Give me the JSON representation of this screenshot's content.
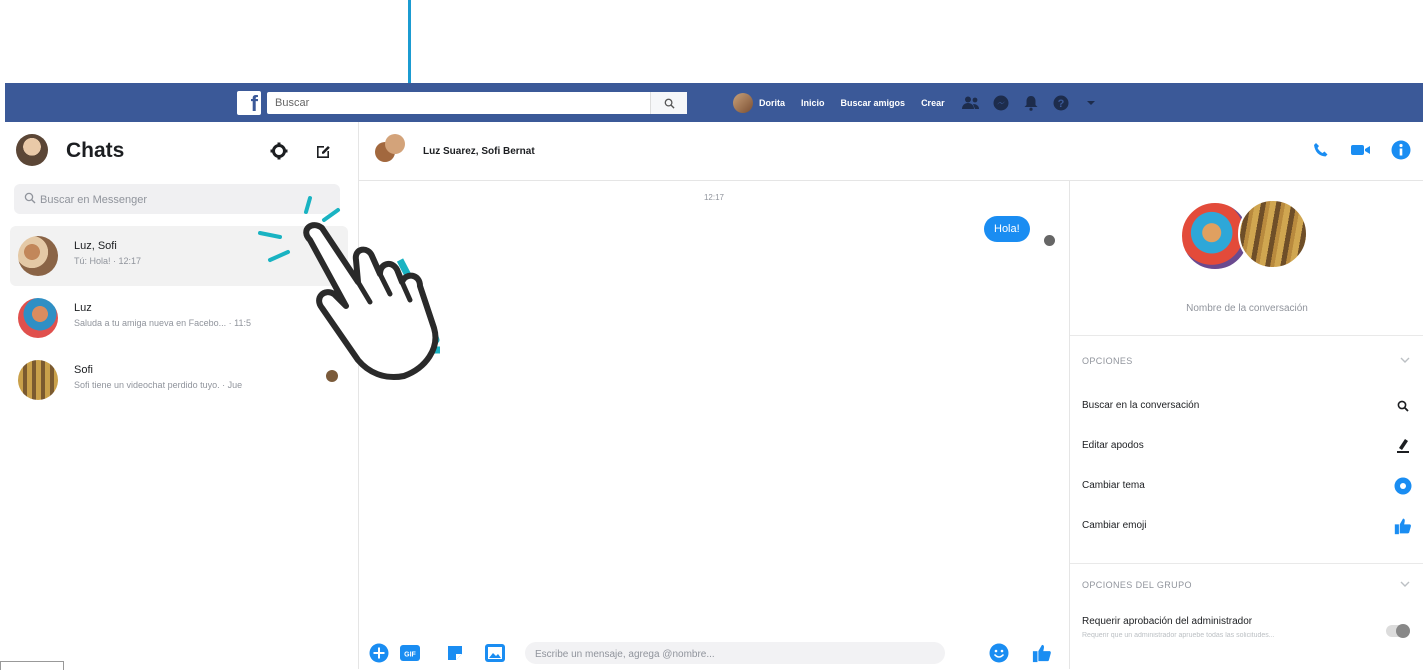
{
  "topbar": {
    "search_placeholder": "Buscar",
    "user_name": "Dorita",
    "links": [
      "Inicio",
      "Buscar amigos",
      "Crear"
    ]
  },
  "left": {
    "title": "Chats",
    "search_placeholder": "Buscar en Messenger",
    "conversations": [
      {
        "name": "Luz, Sofi",
        "snippet": "Tú: Hola! · 12:17",
        "active": true
      },
      {
        "name": "Luz",
        "snippet": "Saluda a tu amiga nueva en Facebo... · 11:5",
        "active": false
      },
      {
        "name": "Sofi",
        "snippet": "Sofi tiene un videochat perdido tuyo. · Jue",
        "active": false
      }
    ]
  },
  "chat": {
    "title": "Luz Suarez, Sofi Bernat",
    "time": "12:17",
    "messages": [
      {
        "text": "Hola!",
        "from": "me"
      }
    ],
    "composer_placeholder": "Escribe un mensaje, agrega @nombre..."
  },
  "info": {
    "conversation_name": "Nombre de la conversación",
    "options_title": "OPCIONES",
    "options": [
      "Buscar en la conversación",
      "Editar apodos",
      "Cambiar tema",
      "Cambiar emoji"
    ],
    "group_options_title": "OPCIONES DEL GRUPO",
    "require_admin_label": "Requerir aprobación del administrador",
    "require_admin_sub": "Requerir que un administrador apruebe todas las solicitudes..."
  },
  "colors": {
    "topbar": "#3b5998",
    "accent": "#1a8df2",
    "hand_accent": "#19b3c2"
  }
}
